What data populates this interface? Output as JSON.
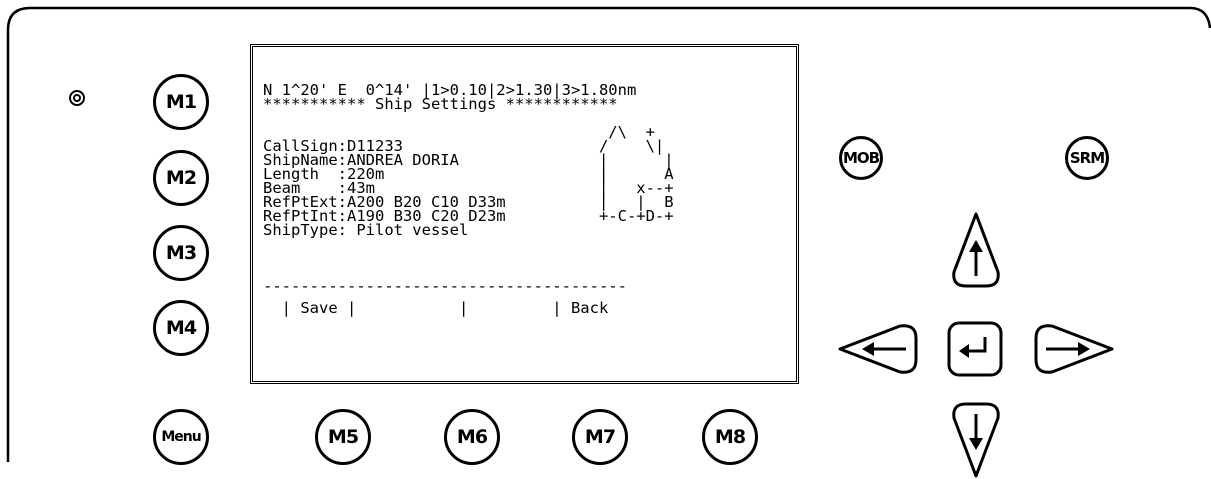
{
  "side_buttons": [
    "M1",
    "M2",
    "M3",
    "M4"
  ],
  "menu_button": "Menu",
  "bottom_buttons": [
    "M5",
    "M6",
    "M7",
    "M8"
  ],
  "mob_button": "MOB",
  "srm_button": "SRM",
  "arrow_buttons": {
    "up": "up-arrow-icon",
    "left": "left-arrow-icon",
    "enter": "enter-arrow-icon",
    "right": "right-arrow-icon",
    "down": "down-arrow-icon"
  },
  "screen": {
    "position_line": "N 1^20' E  0^14' |1>0.10|2>1.30|3>1.80nm",
    "title_line": "*********** Ship Settings ************",
    "lines": [
      "",
      "                                     /\\  +",
      "CallSign:D11233                     /    \\|",
      "ShipName:ANDREA DORIA               |      |",
      "Length  :220m                       |      A",
      "Beam    :43m                        |   x--+",
      "RefPtExt:A200 B20 C10 D33m          |   |  B",
      "RefPtInt:A190 B30 C20 D23m          +-C-+D-+",
      "ShipType: Pilot vessel"
    ],
    "separator": "---------------------------------------",
    "softkeys": "  | Save |           |         | Back"
  }
}
